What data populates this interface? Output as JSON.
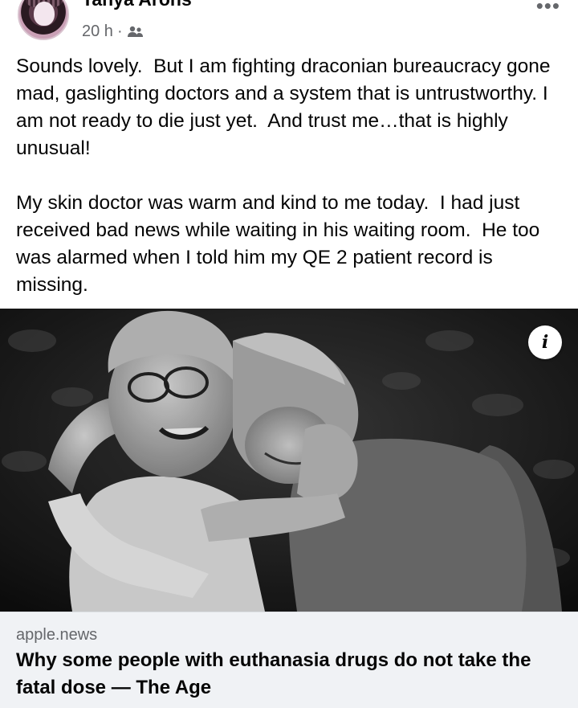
{
  "post": {
    "author": "Tanya Arons",
    "time": "20 h",
    "separator": "·",
    "audience_icon": "friends-icon",
    "more_icon": "more-options-icon",
    "text": "Sounds lovely.  But I am fighting draconian bureaucracy gone mad, gaslighting doctors and a system that is untrustworthy. I am not ready to die just yet.  And trust me…that is highly unusual!\n\nMy skin doctor was warm and kind to me today.  I had just received bad news while waiting in his waiting room.  He too was alarmed when I told him my QE 2 patient record is missing."
  },
  "link": {
    "info_label": "i",
    "domain": "apple.news",
    "title": "Why some people with euthanasia drugs do not take the fatal dose — The Age"
  }
}
